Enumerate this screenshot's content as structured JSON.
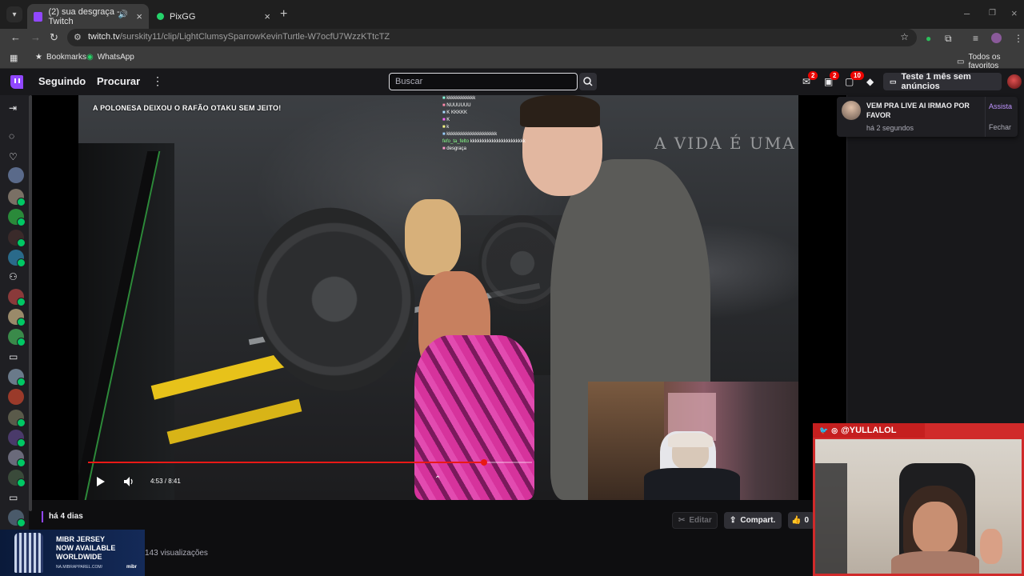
{
  "browser": {
    "tabs": [
      {
        "title": "(2) sua desgraça - Twitch",
        "active": true,
        "audio": true
      },
      {
        "title": "PixGG",
        "active": false,
        "audio": false
      }
    ],
    "url_domain": "twitch.tv",
    "url_path": "/surskity11/clip/LightClumsySparrowKevinTurtle-W7ocfU7WzzKTtcTZ",
    "bookmarks": [
      "Bookmarks",
      "WhatsApp"
    ],
    "all_bookmarks": "Todos os favoritos"
  },
  "twitch_nav": {
    "following": "Seguindo",
    "browse": "Procurar",
    "search_placeholder": "Buscar",
    "badges": {
      "inbox": "2",
      "whispers": "2",
      "notifications": "10"
    },
    "turbo_label": "Teste 1 mês sem anúncios"
  },
  "player": {
    "clip_title_overlay": "A POLONESA DEIXOU O RAFÃO OTAKU SEM JEITO!",
    "wall_text": "A VIDA É UMA SE",
    "time_display": "4:53 / 8:41",
    "progress": 0.892,
    "chat_overlay": [
      {
        "name": "",
        "msg": "kkkkkkkkkkkk"
      },
      {
        "name": "",
        "msg": "NUUUUUU"
      },
      {
        "name": "",
        "msg": "K KKKKK"
      },
      {
        "name": "",
        "msg": "K"
      },
      {
        "name": "",
        "msg": "k"
      },
      {
        "name": "",
        "msg": "kkkkkkkkkkkkkkkkkkkkk"
      },
      {
        "name": "fefo_ta_felto",
        "msg": "kkkkkkkkkkkkkkkkkkkkkkk"
      },
      {
        "name": "",
        "msg": "desgraça"
      }
    ]
  },
  "clip_meta": {
    "age": "há 4 dias",
    "views": "143 visualizações"
  },
  "actions": {
    "edit": "Editar",
    "share": "Compart.",
    "likes": "0"
  },
  "notification": {
    "message": "VEM PRA LIVE AI IRMAO POR FAVOR",
    "time": "há 2 segundos",
    "watch": "Assista",
    "close": "Fechar"
  },
  "ad": {
    "headline": "MIBR JERSEY\nNOW AVAILABLE\nWORLDWIDE",
    "url": "NA.MIBRAPPAREL.COM/",
    "brand": "mibr"
  },
  "streamer_cam": {
    "handle": "@YULLALOL"
  },
  "colors": {
    "twitch_purple": "#9147ff",
    "progress_red": "#e91916",
    "badge_red": "#eb0400",
    "cam_frame": "#d02a2a"
  }
}
